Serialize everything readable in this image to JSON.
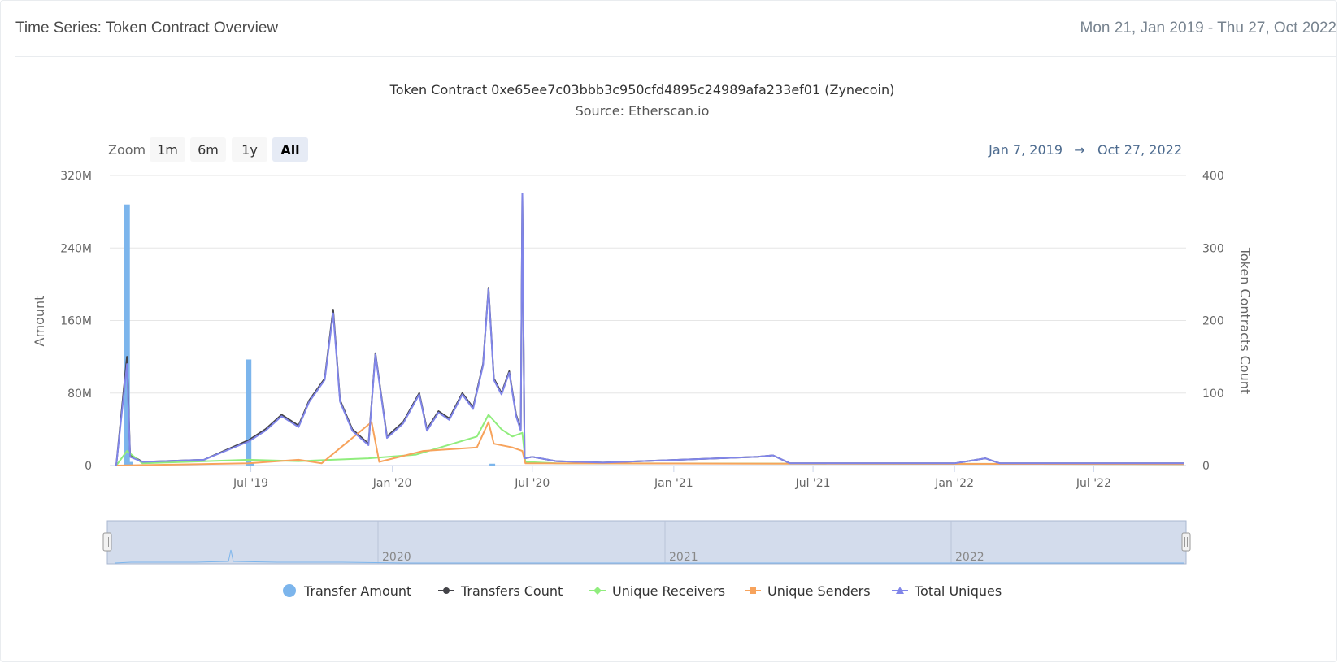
{
  "header": {
    "title": "Time Series: Token Contract Overview",
    "date_range": "Mon 21, Jan 2019 - Thu 27, Oct 2022"
  },
  "chart": {
    "title": "Token Contract 0xe65ee7c03bbb3c950cfd4895c24989afa233ef01 (Zynecoin)",
    "subtitle": "Source: Etherscan.io",
    "zoom_label": "Zoom",
    "zoom_buttons": [
      "1m",
      "6m",
      "1y",
      "All"
    ],
    "zoom_selected": "All",
    "range_from": "Jan 7, 2019",
    "range_arrow": "→",
    "range_to": "Oct 27, 2022"
  },
  "chart_data": {
    "type": "line",
    "x_range": [
      "2019-01-07",
      "2022-10-27"
    ],
    "x_ticks": [
      {
        "date": "2019-07-01",
        "label": "Jul '19"
      },
      {
        "date": "2020-01-01",
        "label": "Jan '20"
      },
      {
        "date": "2020-07-01",
        "label": "Jul '20"
      },
      {
        "date": "2021-01-01",
        "label": "Jan '21"
      },
      {
        "date": "2021-07-01",
        "label": "Jul '21"
      },
      {
        "date": "2022-01-01",
        "label": "Jan '22"
      },
      {
        "date": "2022-07-01",
        "label": "Jul '22"
      }
    ],
    "y_left": {
      "label": "Amount",
      "ylim": [
        0,
        320000000
      ],
      "ticks": [
        {
          "v": 0,
          "label": "0"
        },
        {
          "v": 80000000,
          "label": "80M"
        },
        {
          "v": 160000000,
          "label": "160M"
        },
        {
          "v": 240000000,
          "label": "240M"
        },
        {
          "v": 320000000,
          "label": "320M"
        }
      ]
    },
    "y_right": {
      "label": "Token Contracts Count",
      "ylim": [
        0,
        400
      ],
      "ticks": [
        {
          "v": 0,
          "label": "0"
        },
        {
          "v": 100,
          "label": "100"
        },
        {
          "v": 200,
          "label": "200"
        },
        {
          "v": 300,
          "label": "300"
        },
        {
          "v": 400,
          "label": "400"
        }
      ]
    },
    "grid": true,
    "legend_position": "bottom",
    "series": [
      {
        "name": "Transfer Amount",
        "type": "column",
        "axis": "left",
        "color": "#7cb5ec",
        "points": [
          [
            "2019-01-21",
            288000000
          ],
          [
            "2019-01-25",
            4000000
          ],
          [
            "2019-06-28",
            117000000
          ],
          [
            "2019-07-02",
            3000000
          ],
          [
            "2020-05-10",
            2000000
          ]
        ]
      },
      {
        "name": "Transfers Count",
        "type": "line",
        "axis": "right",
        "color": "#434348",
        "points": [
          [
            "2019-01-07",
            0
          ],
          [
            "2019-01-21",
            150
          ],
          [
            "2019-01-25",
            15
          ],
          [
            "2019-02-10",
            5
          ],
          [
            "2019-05-01",
            8
          ],
          [
            "2019-06-28",
            35
          ],
          [
            "2019-07-20",
            50
          ],
          [
            "2019-08-10",
            70
          ],
          [
            "2019-09-01",
            55
          ],
          [
            "2019-09-15",
            90
          ],
          [
            "2019-10-05",
            120
          ],
          [
            "2019-10-16",
            215
          ],
          [
            "2019-10-25",
            90
          ],
          [
            "2019-11-10",
            50
          ],
          [
            "2019-12-01",
            30
          ],
          [
            "2019-12-10",
            155
          ],
          [
            "2019-12-25",
            40
          ],
          [
            "2020-01-15",
            60
          ],
          [
            "2020-02-05",
            100
          ],
          [
            "2020-02-15",
            50
          ],
          [
            "2020-03-01",
            75
          ],
          [
            "2020-03-15",
            65
          ],
          [
            "2020-04-01",
            100
          ],
          [
            "2020-04-15",
            80
          ],
          [
            "2020-04-28",
            140
          ],
          [
            "2020-05-05",
            245
          ],
          [
            "2020-05-12",
            120
          ],
          [
            "2020-05-22",
            100
          ],
          [
            "2020-06-01",
            130
          ],
          [
            "2020-06-10",
            70
          ],
          [
            "2020-06-16",
            50
          ],
          [
            "2020-06-18",
            375
          ],
          [
            "2020-06-21",
            10
          ],
          [
            "2020-07-01",
            12
          ],
          [
            "2020-08-01",
            6
          ],
          [
            "2020-10-01",
            4
          ],
          [
            "2021-04-20",
            12
          ],
          [
            "2021-05-10",
            14
          ],
          [
            "2021-06-01",
            3
          ],
          [
            "2022-01-01",
            3
          ],
          [
            "2022-02-10",
            10
          ],
          [
            "2022-03-01",
            3
          ],
          [
            "2022-10-27",
            3
          ]
        ]
      },
      {
        "name": "Unique Receivers",
        "type": "line",
        "axis": "right",
        "color": "#90ed7d",
        "points": [
          [
            "2019-01-07",
            0
          ],
          [
            "2019-01-21",
            20
          ],
          [
            "2019-02-10",
            3
          ],
          [
            "2019-06-28",
            8
          ],
          [
            "2019-09-01",
            6
          ],
          [
            "2019-12-01",
            10
          ],
          [
            "2020-02-01",
            15
          ],
          [
            "2020-04-20",
            40
          ],
          [
            "2020-05-05",
            70
          ],
          [
            "2020-05-22",
            50
          ],
          [
            "2020-06-05",
            40
          ],
          [
            "2020-06-18",
            45
          ],
          [
            "2020-06-22",
            5
          ],
          [
            "2020-08-01",
            3
          ],
          [
            "2022-10-27",
            2
          ]
        ]
      },
      {
        "name": "Unique Senders",
        "type": "line",
        "axis": "right",
        "color": "#f7a35c",
        "points": [
          [
            "2019-01-07",
            0
          ],
          [
            "2019-06-28",
            3
          ],
          [
            "2019-09-01",
            8
          ],
          [
            "2019-10-01",
            3
          ],
          [
            "2019-12-05",
            60
          ],
          [
            "2019-12-15",
            5
          ],
          [
            "2020-02-10",
            20
          ],
          [
            "2020-04-20",
            25
          ],
          [
            "2020-05-05",
            60
          ],
          [
            "2020-05-12",
            30
          ],
          [
            "2020-06-05",
            25
          ],
          [
            "2020-06-18",
            20
          ],
          [
            "2020-06-22",
            3
          ],
          [
            "2022-10-27",
            2
          ]
        ]
      },
      {
        "name": "Total Uniques",
        "type": "line",
        "axis": "right",
        "color": "#8085e9",
        "points": [
          [
            "2019-01-07",
            0
          ],
          [
            "2019-01-21",
            140
          ],
          [
            "2019-01-25",
            12
          ],
          [
            "2019-02-10",
            5
          ],
          [
            "2019-05-01",
            8
          ],
          [
            "2019-06-28",
            33
          ],
          [
            "2019-07-20",
            48
          ],
          [
            "2019-08-10",
            68
          ],
          [
            "2019-09-01",
            53
          ],
          [
            "2019-09-15",
            88
          ],
          [
            "2019-10-05",
            118
          ],
          [
            "2019-10-16",
            210
          ],
          [
            "2019-10-25",
            88
          ],
          [
            "2019-11-10",
            48
          ],
          [
            "2019-12-01",
            28
          ],
          [
            "2019-12-10",
            153
          ],
          [
            "2019-12-25",
            38
          ],
          [
            "2020-01-15",
            58
          ],
          [
            "2020-02-05",
            98
          ],
          [
            "2020-02-15",
            48
          ],
          [
            "2020-03-01",
            73
          ],
          [
            "2020-03-15",
            63
          ],
          [
            "2020-04-01",
            98
          ],
          [
            "2020-04-15",
            78
          ],
          [
            "2020-04-28",
            138
          ],
          [
            "2020-05-05",
            243
          ],
          [
            "2020-05-12",
            118
          ],
          [
            "2020-05-22",
            98
          ],
          [
            "2020-06-01",
            128
          ],
          [
            "2020-06-10",
            68
          ],
          [
            "2020-06-16",
            48
          ],
          [
            "2020-06-18",
            375
          ],
          [
            "2020-06-21",
            10
          ],
          [
            "2020-07-01",
            12
          ],
          [
            "2020-08-01",
            6
          ],
          [
            "2020-10-01",
            4
          ],
          [
            "2021-04-20",
            12
          ],
          [
            "2021-05-10",
            14
          ],
          [
            "2021-06-01",
            3
          ],
          [
            "2022-01-01",
            3
          ],
          [
            "2022-02-10",
            10
          ],
          [
            "2022-03-01",
            3
          ],
          [
            "2022-10-27",
            3
          ]
        ]
      }
    ],
    "navigator_labels": [
      "2020",
      "2021",
      "2022"
    ]
  }
}
